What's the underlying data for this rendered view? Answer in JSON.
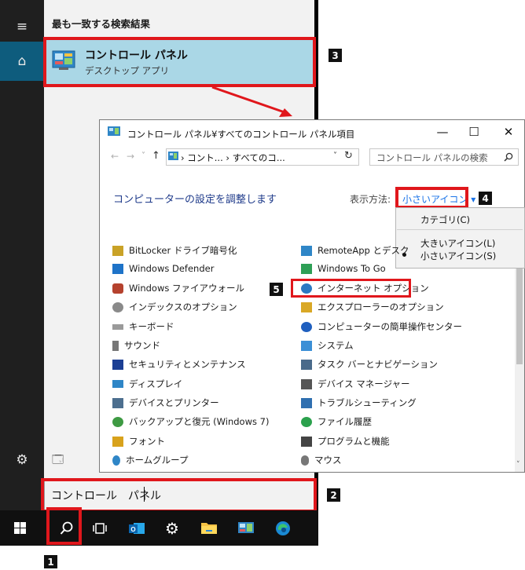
{
  "start_menu": {
    "best_match_heading": "最も一致する検索結果",
    "result": {
      "title": "コントロール パネル",
      "subtitle": "デスクトップ アプリ"
    },
    "search_query": "コントロール　パネル"
  },
  "taskbar": {
    "buttons": [
      "windows-start",
      "search",
      "task-view",
      "outlook",
      "settings",
      "file-explorer",
      "control-panel",
      "edge"
    ]
  },
  "control_panel": {
    "title": "コントロール パネル¥すべてのコントロール パネル項目",
    "address": "› コント... › すべてのコ...",
    "search_placeholder": "コントロール パネルの検索",
    "heading": "コンピューターの設定を調整します",
    "view_label": "表示方法:",
    "view_value": "小さいアイコン ▾",
    "view_menu": [
      "カテゴリ(C)",
      "大きいアイコン(L)",
      "小さいアイコン(S)"
    ],
    "left_items": [
      "BitLocker ドライブ暗号化",
      "Windows Defender",
      "Windows ファイアウォール",
      "インデックスのオプション",
      "キーボード",
      "サウンド",
      "セキュリティとメンテナンス",
      "ディスプレイ",
      "デバイスとプリンター",
      "バックアップと復元 (Windows 7)",
      "フォント",
      "ホームグループ"
    ],
    "right_items": [
      "RemoteApp とデスク",
      "Windows To Go",
      "インターネット オプション",
      "エクスプローラーのオプション",
      "コンピューターの簡単操作センター",
      "システム",
      "タスク バーとナビゲーション",
      "デバイス マネージャー",
      "トラブルシューティング",
      "ファイル履歴",
      "プログラムと機能",
      "マウス"
    ]
  },
  "step_badges": [
    "1",
    "2",
    "3",
    "4",
    "5"
  ],
  "colors": {
    "highlight": "#e0171c",
    "result_bg": "#aad7e6",
    "link": "#1a73e8"
  }
}
